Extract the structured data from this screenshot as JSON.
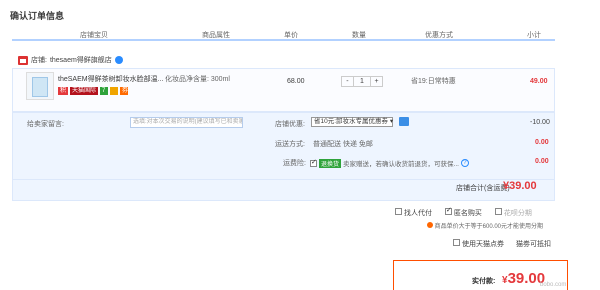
{
  "page_title": "确认订单信息",
  "columns": [
    "店铺宝贝",
    "商品属性",
    "单价",
    "数量",
    "优惠方式",
    "小计"
  ],
  "shop": {
    "prefix": "店铺:",
    "name": "thesaem得鲜旗舰店"
  },
  "item": {
    "title": "theSAEM得鲜茶树卸妆水脸部温...",
    "property": "化妆品净含量: 300ml",
    "price": "68.00",
    "quantity": "1",
    "minus": "-",
    "plus": "+",
    "promotion": "省19:日常特惠",
    "subtotal": "49.00",
    "badges": [
      "积",
      "天猫国际",
      "7",
      "",
      "券"
    ]
  },
  "memo": {
    "label": "给卖家留言:",
    "placeholder": "选填:对本次交易的说明(建议填写已和卖家协商一致的内容)"
  },
  "shop_discount": {
    "label": "店铺优惠:",
    "value": "省10元:卸妆水专属优惠券 ▾",
    "amount": "-10.00"
  },
  "shipping": {
    "label": "运送方式:",
    "value": "普通配送 快递 免邮",
    "amount": "0.00"
  },
  "insurance": {
    "label": "运费险:",
    "badge": "退换货",
    "text": "卖家赠送，若确认收货前退货，可获保...",
    "amount": "0.00"
  },
  "shop_total": {
    "label": "店铺合计(含运费)",
    "value": "¥39.00"
  },
  "options": {
    "proxy": "找人代付",
    "anonymous": "匿名购买",
    "installment": "花呗分期"
  },
  "installment_note": "商品单价大于等于600.00元才能使用分期",
  "coin": {
    "label": "使用天猫点券",
    "value": "猫劵可抵扣"
  },
  "pay": {
    "label": "实付款:",
    "symbol": "¥",
    "value": "39.00"
  },
  "watermark": "bobo.com"
}
